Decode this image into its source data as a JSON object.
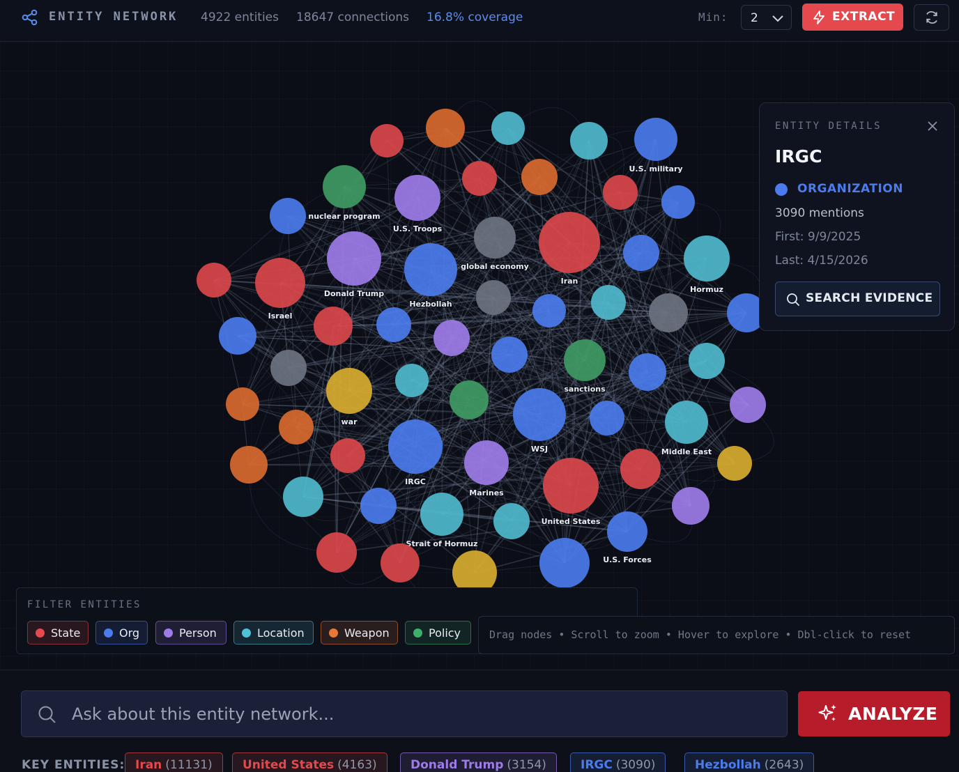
{
  "header": {
    "title": "ENTITY NETWORK",
    "entities": "4922 entities",
    "connections": "18647 connections",
    "coverage": "16.8% coverage",
    "min_label": "Min:",
    "min_value": "2",
    "extract_label": "EXTRACT"
  },
  "colors": {
    "state": "#d9474b",
    "org": "#4b7bec",
    "person": "#9d7ce8",
    "location": "#4fb8cc",
    "weapon": "#d9692f",
    "policy": "#3f9a64",
    "concept": "#6c7380",
    "event": "#d8ab2f"
  },
  "details": {
    "heading": "ENTITY DETAILS",
    "name": "IRGC",
    "type": "ORGANIZATION",
    "mentions": "3090 mentions",
    "first": "First: 9/9/2025",
    "last": "Last: 4/15/2026",
    "search_label": "SEARCH EVIDENCE"
  },
  "filters": {
    "heading": "FILTER ENTITIES",
    "items": [
      {
        "label": "State",
        "color": "#e5484d"
      },
      {
        "label": "Org",
        "color": "#4b7bec"
      },
      {
        "label": "Person",
        "color": "#9d7ce8"
      },
      {
        "label": "Location",
        "color": "#4fc3d6"
      },
      {
        "label": "Weapon",
        "color": "#e6793a"
      },
      {
        "label": "Policy",
        "color": "#3fae6a"
      }
    ]
  },
  "hint": "Drag nodes • Scroll to zoom • Hover to explore • Dbl-click to reset",
  "ask": {
    "placeholder": "Ask about this entity network...",
    "analyze_label": "ANALYZE"
  },
  "key_entities": {
    "label": "KEY ENTITIES:",
    "items": [
      {
        "name": "Iran",
        "count": "(11131)",
        "color": "#e5484d"
      },
      {
        "name": "United States",
        "count": "(4163)",
        "color": "#e5484d"
      },
      {
        "name": "Donald Trump",
        "count": "(3154)",
        "color": "#9d7ce8"
      },
      {
        "name": "IRGC",
        "count": "(3090)",
        "color": "#4b7bec"
      },
      {
        "name": "Hezbollah",
        "count": "(2643)",
        "color": "#4b7bec"
      }
    ]
  },
  "graph": {
    "nodes": [
      {
        "label": "",
        "type": "state"
      },
      {
        "label": "",
        "type": "weapon"
      },
      {
        "label": "",
        "type": "location"
      },
      {
        "label": "",
        "type": "location"
      },
      {
        "label": "U.S. military",
        "type": "org"
      },
      {
        "label": "",
        "type": "state"
      },
      {
        "label": "",
        "type": "weapon"
      },
      {
        "label": "",
        "type": "state"
      },
      {
        "label": "",
        "type": "org"
      },
      {
        "label": "nuclear program",
        "type": "policy"
      },
      {
        "label": "U.S. Troops",
        "type": "person"
      },
      {
        "label": "",
        "type": "org"
      },
      {
        "label": "global economy",
        "type": "concept"
      },
      {
        "label": "Iran",
        "type": "state"
      },
      {
        "label": "",
        "type": "org"
      },
      {
        "label": "Hormuz",
        "type": "location"
      },
      {
        "label": "",
        "type": "state"
      },
      {
        "label": "Israel",
        "type": "state"
      },
      {
        "label": "Donald Trump",
        "type": "person"
      },
      {
        "label": "Hezbollah",
        "type": "org"
      },
      {
        "label": "",
        "type": "concept"
      },
      {
        "label": "",
        "type": "org"
      },
      {
        "label": "",
        "type": "location"
      },
      {
        "label": "",
        "type": "concept"
      },
      {
        "label": "",
        "type": "org"
      },
      {
        "label": "",
        "type": "org"
      },
      {
        "label": "",
        "type": "state"
      },
      {
        "label": "",
        "type": "org"
      },
      {
        "label": "",
        "type": "person"
      },
      {
        "label": "",
        "type": "concept"
      },
      {
        "label": "",
        "type": "org"
      },
      {
        "label": "sanctions",
        "type": "policy"
      },
      {
        "label": "",
        "type": "location"
      },
      {
        "label": "",
        "type": "org"
      },
      {
        "label": "war",
        "type": "event"
      },
      {
        "label": "",
        "type": "location"
      },
      {
        "label": "",
        "type": "weapon"
      },
      {
        "label": "",
        "type": "weapon"
      },
      {
        "label": "",
        "type": "policy"
      },
      {
        "label": "WSJ",
        "type": "org"
      },
      {
        "label": "",
        "type": "org"
      },
      {
        "label": "Middle East",
        "type": "location"
      },
      {
        "label": "",
        "type": "person"
      },
      {
        "label": "",
        "type": "weapon"
      },
      {
        "label": "",
        "type": "state"
      },
      {
        "label": "IRGC",
        "type": "org"
      },
      {
        "label": "Marines",
        "type": "person"
      },
      {
        "label": "",
        "type": "state"
      },
      {
        "label": "",
        "type": "event"
      },
      {
        "label": "",
        "type": "location"
      },
      {
        "label": "",
        "type": "org"
      },
      {
        "label": "Strait of Hormuz",
        "type": "location"
      },
      {
        "label": "",
        "type": "location"
      },
      {
        "label": "United States",
        "type": "state"
      },
      {
        "label": "",
        "type": "person"
      },
      {
        "label": "",
        "type": "state"
      },
      {
        "label": "",
        "type": "state"
      },
      {
        "label": "U.S. Forces",
        "type": "org"
      },
      {
        "label": "",
        "type": "event"
      },
      {
        "label": "",
        "type": "org"
      }
    ]
  }
}
